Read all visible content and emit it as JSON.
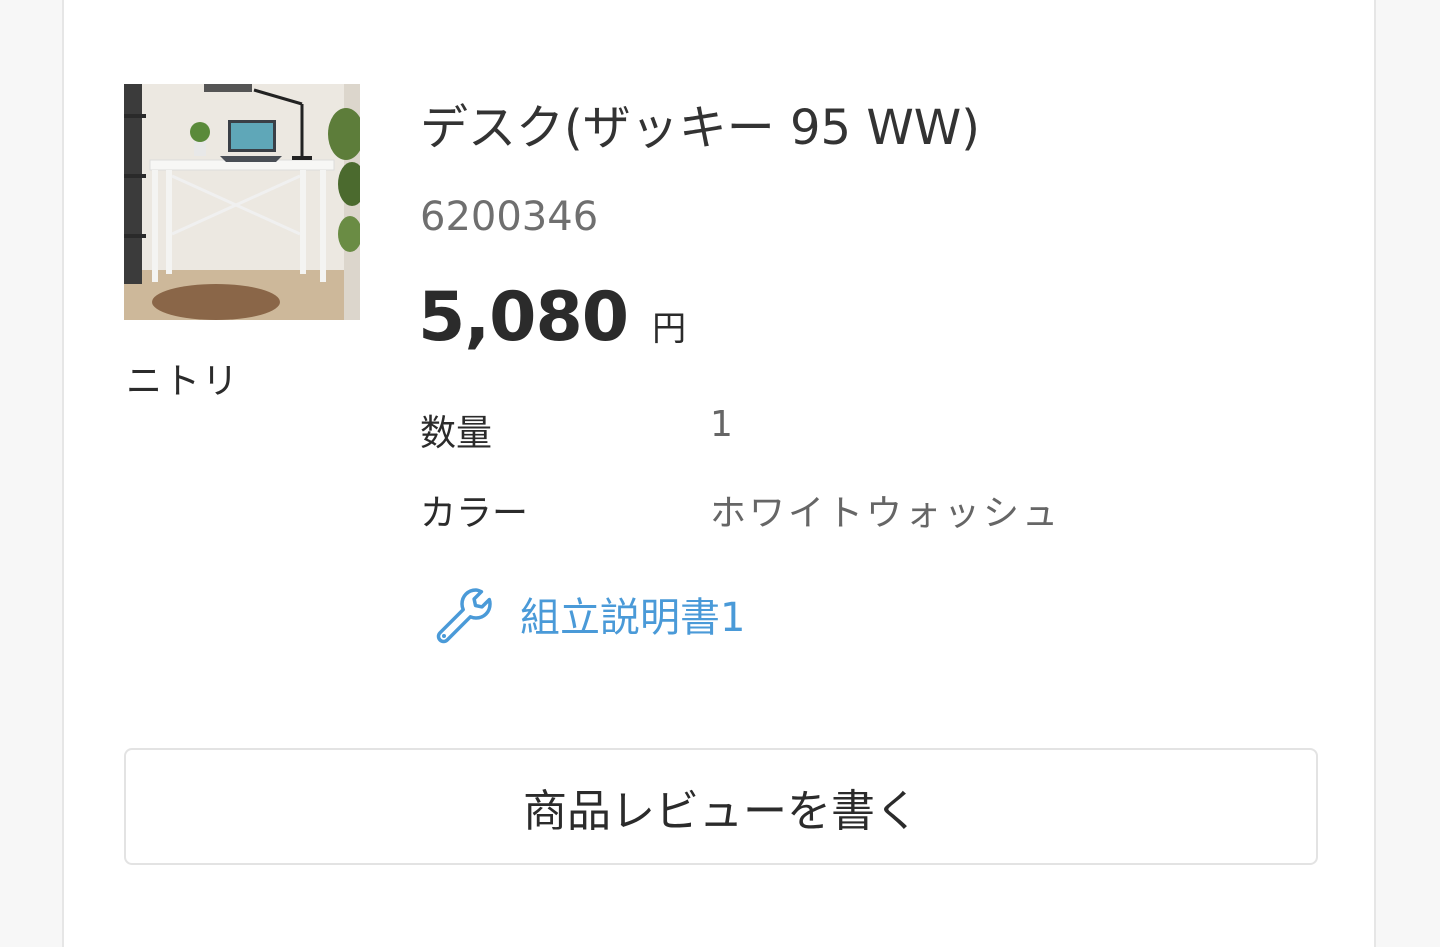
{
  "product": {
    "brand": "ニトリ",
    "title": "デスク(ザッキー 95 WW)",
    "code": "6200346",
    "price": "5,080",
    "currency": "円",
    "specs": [
      {
        "label": "数量",
        "value": "1"
      },
      {
        "label": "カラー",
        "value": "ホワイトウォッシュ"
      }
    ],
    "manual_link": "組立説明書1",
    "image_icon": "desk-photo"
  },
  "actions": {
    "review_button": "商品レビューを書く"
  },
  "colors": {
    "link": "#4a9ad8",
    "text": "#2b2b2b",
    "muted": "#6f6f6f",
    "border": "#e3e3e3"
  }
}
